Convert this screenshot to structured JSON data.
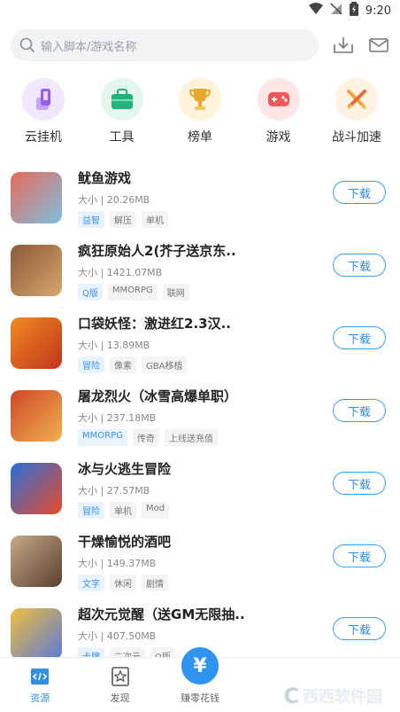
{
  "status_bar": {
    "time": "9:20"
  },
  "search": {
    "placeholder": "输入脚本/游戏名称"
  },
  "categories": [
    {
      "label": "云挂机",
      "icon": "phone-icon",
      "color": "#9b5cf3",
      "bg": "#f1e8ff"
    },
    {
      "label": "工具",
      "icon": "toolbox-icon",
      "color": "#22b37a",
      "bg": "#e3f7ee"
    },
    {
      "label": "榜单",
      "icon": "trophy-icon",
      "color": "#e7a82b",
      "bg": "#fff3dc"
    },
    {
      "label": "游戏",
      "icon": "gamepad-icon",
      "color": "#f0575a",
      "bg": "#ffe6e6"
    },
    {
      "label": "战斗加速",
      "icon": "swords-icon",
      "color": "#f3a23a",
      "bg": "#fff2e0"
    }
  ],
  "games": [
    {
      "title": "鱿鱼游戏",
      "size": "大小 | 20.26MB",
      "tags": [
        "益智",
        "解压",
        "单机"
      ],
      "button": "下载",
      "thumb": [
        "#e66a5a",
        "#7fbfe0"
      ]
    },
    {
      "title": "疯狂原始人2(芥子送京东..",
      "size": "大小 | 1421.07MB",
      "tags": [
        "Q版",
        "MMORPG",
        "联网"
      ],
      "button": "下载",
      "thumb": [
        "#8a5a3a",
        "#d8a56a"
      ]
    },
    {
      "title": "口袋妖怪：激进红2.3汉..",
      "size": "大小 | 13.89MB",
      "tags": [
        "冒险",
        "像素",
        "GBA移植"
      ],
      "button": "下载",
      "thumb": [
        "#f08a20",
        "#c0341e"
      ]
    },
    {
      "title": "屠龙烈火（冰雪高爆单职）",
      "size": "大小 | 237.18MB",
      "tags": [
        "MMORPG",
        "传奇",
        "上线送充值"
      ],
      "button": "下载",
      "thumb": [
        "#d04828",
        "#f0b050"
      ]
    },
    {
      "title": "冰与火逃生冒险",
      "size": "大小 | 27.57MB",
      "tags": [
        "冒险",
        "单机",
        "Mod"
      ],
      "button": "下载",
      "thumb": [
        "#2a6fd8",
        "#e84a2a"
      ]
    },
    {
      "title": "干燥愉悦的酒吧",
      "size": "大小 | 149.37MB",
      "tags": [
        "文字",
        "休闲",
        "剧情"
      ],
      "button": "下载",
      "thumb": [
        "#c8a888",
        "#5a4030"
      ]
    },
    {
      "title": "超次元觉醒（送GM无限抽..",
      "size": "大小 | 407.50MB",
      "tags": [
        "卡牌",
        "二次元",
        "Q版"
      ],
      "button": "下载",
      "thumb": [
        "#f0c040",
        "#5a7ad8"
      ]
    }
  ],
  "bottom_nav": {
    "items": [
      {
        "label": "资源",
        "icon": "code-icon",
        "active": true
      },
      {
        "label": "发现",
        "icon": "star-bookmark-icon",
        "active": false
      },
      {
        "label": "赚零花钱",
        "icon": "yen-icon",
        "active": false
      },
      {
        "label": "",
        "icon": "",
        "active": false
      },
      {
        "label": "",
        "icon": "",
        "active": false
      }
    ],
    "center_symbol": "¥"
  },
  "watermark": {
    "text": "西西软件园"
  }
}
